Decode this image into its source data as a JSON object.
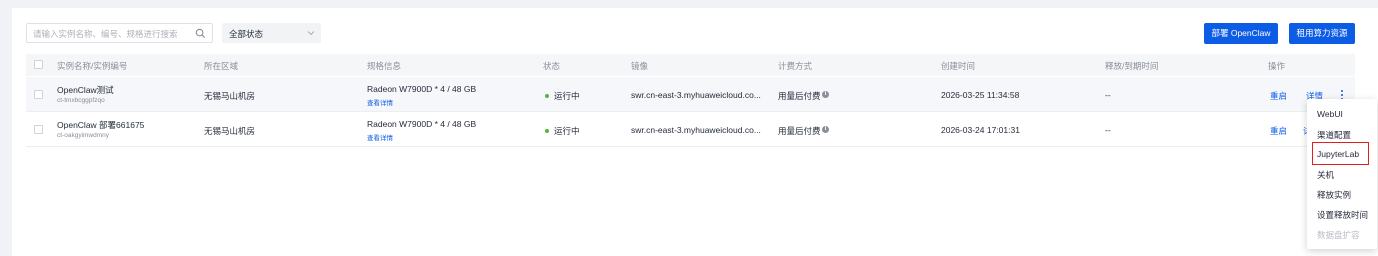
{
  "toolbar": {
    "search_placeholder": "请输入实例名称、编号、规格进行搜索",
    "status_filter": "全部状态",
    "deploy_button": "部署 OpenClaw",
    "rent_button": "租用算力资源"
  },
  "table": {
    "columns": [
      "实例名称/实例编号",
      "所在区域",
      "规格信息",
      "状态",
      "镜像",
      "计费方式",
      "创建时间",
      "释放/到期时间",
      "操作"
    ],
    "rows": [
      {
        "name": "OpenClaw测试",
        "id": "ct-tmxbcggpfzqo",
        "region": "无锡马山机房",
        "spec": "Radeon W7900D * 4 / 48 GB",
        "spec_link": "查看详情",
        "status": "运行中",
        "image": "swr.cn-east-3.myhuaweicloud.co...",
        "billing": "用量后付费",
        "created": "2026-03-25 11:34:58",
        "release": "--",
        "action_restart": "重启",
        "action_detail": "详情"
      },
      {
        "name": "OpenClaw 部署661675",
        "id": "ct-oakgyimwdmny",
        "region": "无锡马山机房",
        "spec": "Radeon W7900D * 4 / 48 GB",
        "spec_link": "查看详情",
        "status": "运行中",
        "image": "swr.cn-east-3.myhuaweicloud.co...",
        "billing": "用量后付费",
        "created": "2026-03-24 17:01:31",
        "release": "--",
        "action_restart": "重启",
        "action_detail": "详"
      }
    ]
  },
  "menu": {
    "items": [
      "WebUI",
      "渠道配置",
      "JupyterLab",
      "关机",
      "释放实例",
      "设置释放时间",
      "数据盘扩容"
    ],
    "highlighted": "JupyterLab",
    "disabled": "数据盘扩容"
  },
  "colors": {
    "primary": "#0d5ce6",
    "running": "#50b83c",
    "highlight_border": "#e02020"
  }
}
